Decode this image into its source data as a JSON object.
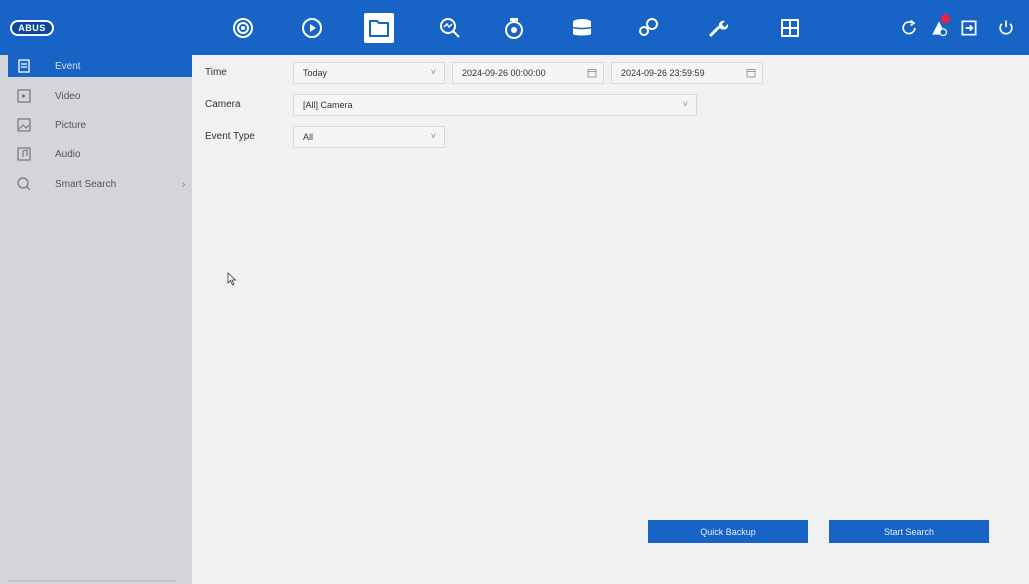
{
  "brand": {
    "logo_text": "ABUS"
  },
  "topnav": {
    "items": [
      {
        "name": "live-view-icon"
      },
      {
        "name": "playback-icon"
      },
      {
        "name": "file-management-icon"
      },
      {
        "name": "smart-analysis-icon"
      },
      {
        "name": "camera-icon"
      },
      {
        "name": "storage-icon"
      },
      {
        "name": "system-settings-icon"
      },
      {
        "name": "maintenance-icon"
      },
      {
        "name": "multi-view-icon"
      }
    ],
    "active": "file-management-icon",
    "right_items": [
      {
        "name": "refresh-icon"
      },
      {
        "name": "alarm-icon"
      },
      {
        "name": "logout-icon"
      },
      {
        "name": "power-icon"
      }
    ]
  },
  "sidebar": {
    "items": [
      {
        "label": "Event",
        "icon": "event-icon",
        "active": true
      },
      {
        "label": "Video",
        "icon": "video-icon",
        "active": false
      },
      {
        "label": "Picture",
        "icon": "picture-icon",
        "active": false
      },
      {
        "label": "Audio",
        "icon": "audio-icon",
        "active": false
      },
      {
        "label": "Smart Search",
        "icon": "smart-search-icon",
        "active": false,
        "arrow": "›"
      }
    ]
  },
  "form": {
    "time_label": "Time",
    "time_value": "Today",
    "start_time": "2024-09-26 00:00:00",
    "end_time": "2024-09-26 23:59:59",
    "camera_label": "Camera",
    "camera_value": "[All] Camera",
    "event_type_label": "Event Type",
    "event_type_value": "All",
    "caret": "˅"
  },
  "actions": {
    "quick_backup": "Quick Backup",
    "start_search": "Start Search"
  },
  "colors": {
    "accent": "#1763c6",
    "sidebar_bg": "#d4d5da",
    "page_bg": "#f1f1f1"
  }
}
